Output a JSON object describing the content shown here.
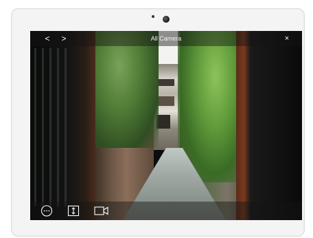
{
  "app": {
    "title": "All Camera"
  },
  "topbar": {
    "back_label": "<",
    "forward_label": ">",
    "close_label": "×"
  },
  "bottombar": {
    "tools": [
      {
        "icon": "more-options-icon"
      },
      {
        "icon": "switch-camera-icon"
      },
      {
        "icon": "video-camera-icon"
      }
    ]
  },
  "colors": {
    "bar_overlay": "#141414",
    "icon": "#ffffff"
  }
}
